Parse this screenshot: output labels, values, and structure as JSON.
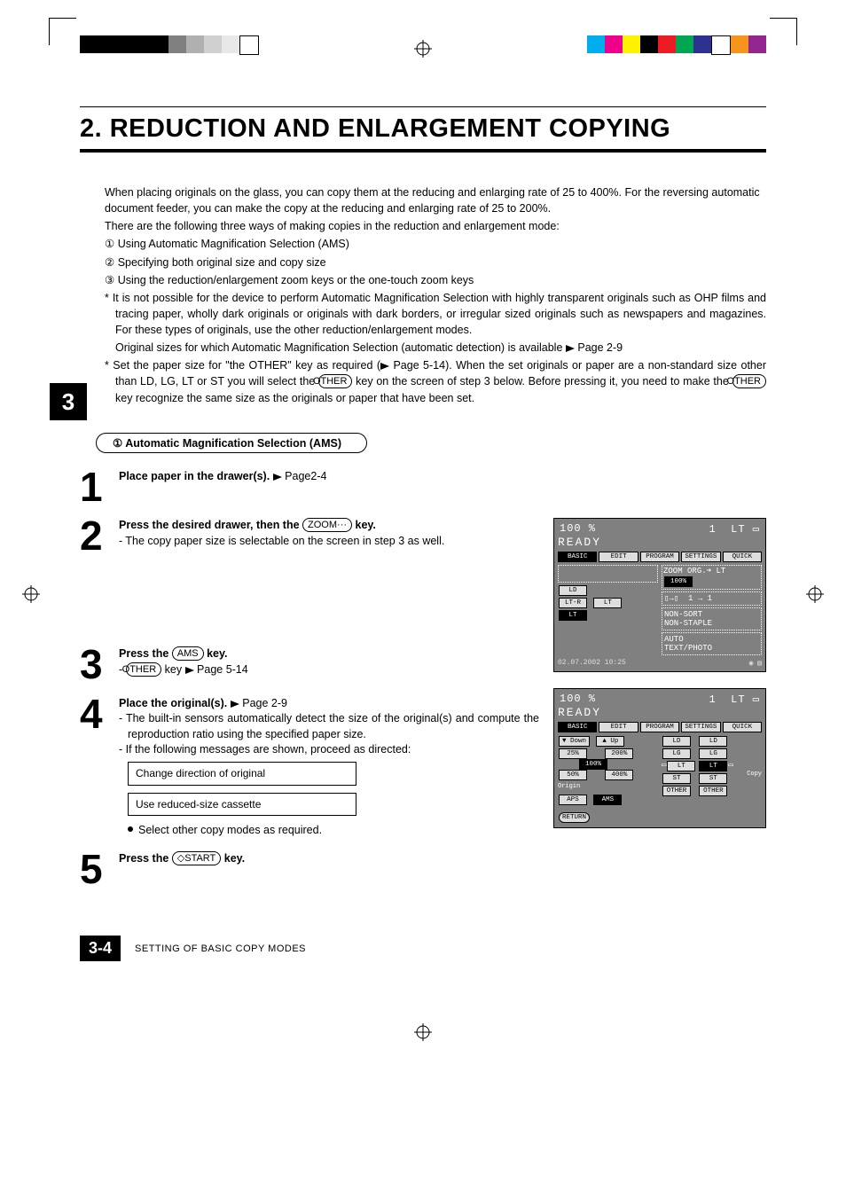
{
  "print_marks": {
    "left_bars": [
      "#000000",
      "#000000",
      "#000000",
      "#000000",
      "#000000",
      "#808080",
      "#b0b0b0",
      "#d0d0d0",
      "#e8e8e8",
      "#ffffff"
    ],
    "right_bars": [
      "#00aeef",
      "#ec008c",
      "#fff200",
      "#000000",
      "#ed1c24",
      "#00a651",
      "#2e3192",
      "#ffffff",
      "#f7941d",
      "#92278f"
    ]
  },
  "tab_number": "3",
  "title": "2. REDUCTION AND ENLARGEMENT COPYING",
  "intro": {
    "p1": "When placing originals on the glass, you can copy them at the reducing and enlarging rate of 25 to 400%. For the reversing automatic document feeder, you can make the copy at the reducing and enlarging rate of 25 to 200%.",
    "p2": "There are the following three ways of making copies in the reduction and enlargement mode:",
    "li1": "Using Automatic Magnification Selection (AMS)",
    "li2": "Specifying both original size and copy size",
    "li3": "Using the reduction/enlargement zoom keys or the one-touch zoom keys",
    "star1": "It is not possible for the device to perform Automatic Magnification Selection with highly transparent originals such as OHP films and tracing paper, wholly dark originals or originals with dark borders, or irregular sized originals such as newspapers and magazines. For these types of originals, use the other reduction/enlargement modes.",
    "star1b": "Original sizes for which Automatic Magnification Selection (automatic detection) is available",
    "star1b_ref": "Page 2-9",
    "star2a": "Set the paper size for \"the OTHER\" key as required (",
    "star2a_ref": "Page 5-14).  When the set originals or paper are a non-standard size other than LD, LG, LT or ST you will select the ",
    "star2b": " key on the screen of step 3 below.  Before pressing it, you need to make the ",
    "star2c": " key recognize the same size as the originals or paper that have been set.",
    "other_key": "OTHER"
  },
  "subhead": "Automatic Magnification Selection (AMS)",
  "subhead_num": "①",
  "steps": {
    "s1": {
      "num": "1",
      "lead": "Place paper in the drawer(s).",
      "ref": "Page2-4"
    },
    "s2": {
      "num": "2",
      "lead_a": "Press the desired drawer, then the ",
      "key": "ZOOM···",
      "lead_b": " key.",
      "sub": "- The copy paper size is selectable on the screen in step 3 as well."
    },
    "s3": {
      "num": "3",
      "lead_a": "Press the ",
      "key": "AMS",
      "lead_b": " key.",
      "sub_a": "- ",
      "sub_key": "OTHER",
      "sub_b": " key ",
      "sub_ref": "Page 5-14"
    },
    "s4": {
      "num": "4",
      "lead": "Place the original(s).",
      "ref": "Page 2-9",
      "sub1": "- The built-in sensors automatically detect the size of the original(s) and compute the reproduction ratio using the specified paper size.",
      "sub2": "- If the following messages are shown, proceed as directed:",
      "msg1": "Change direction of original",
      "msg2": "Use reduced-size cassette",
      "bullet": "Select other copy modes as required."
    },
    "s5": {
      "num": "5",
      "lead_a": "Press the ",
      "key": "START",
      "lead_b": " key."
    }
  },
  "screen1": {
    "pct": "100 %",
    "count": "1",
    "paper": "LT",
    "ready": "READY",
    "tabs": [
      "BASIC",
      "EDIT",
      "PROGRAM",
      "SETTINGS",
      "QUICK"
    ],
    "rows": [
      "LD",
      "LT-R",
      "LT"
    ],
    "row_r": "LT",
    "zoom_lbl": "ZOOM",
    "org_lbl": "ORG.➜ LT",
    "zoom_val": "100%",
    "dup": "1 → 1",
    "sort": "NON-SORT\nNON-STAPLE",
    "mode": "AUTO\nTEXT/PHOTO",
    "date": "02.07.2002 10:25"
  },
  "screen2": {
    "pct": "100 %",
    "count": "1",
    "paper": "LT",
    "ready": "READY",
    "tabs": [
      "BASIC",
      "EDIT",
      "PROGRAM",
      "SETTINGS",
      "QUICK"
    ],
    "down": "▼ Down",
    "up": "▲  Up",
    "p25": "25%",
    "p50": "50%",
    "p100": "100%",
    "p200": "200%",
    "p400": "400%",
    "origin": "Origin",
    "aps": "APS",
    "ams": "AMS",
    "sizes_l": [
      "LD",
      "LG",
      "LT",
      "ST"
    ],
    "sizes_r": [
      "LD",
      "LG",
      "LT",
      "ST"
    ],
    "other": "OTHER",
    "copy": "Copy",
    "return": "RETURN"
  },
  "footer": {
    "page": "3-4",
    "text": "SETTING OF BASIC COPY MODES"
  }
}
